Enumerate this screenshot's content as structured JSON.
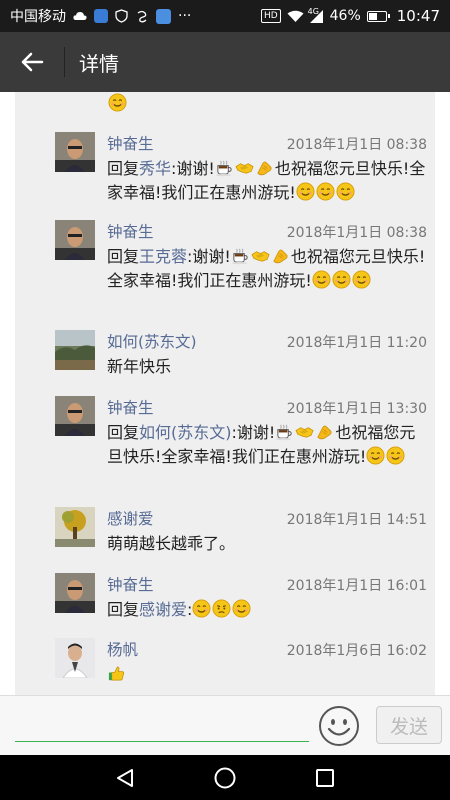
{
  "status_bar": {
    "carrier": "中国移动",
    "network": "4G",
    "battery_text": "46%",
    "battery_level": 0.46,
    "time": "10:47",
    "more": "···",
    "hd": "HD"
  },
  "header": {
    "title": "详情",
    "back_icon": "arrow-left-icon"
  },
  "comments": [
    {
      "name": "钟奋生",
      "time": "2018年1月1日 08:38",
      "reply_prefix": "回复",
      "reply_to": "秀华",
      "text_line1": ":谢谢!",
      "text_mid": "也祝福您元旦快乐!全家幸福!我们正在惠州游玩!",
      "avatar": "avatar-man-glasses"
    },
    {
      "name": "钟奋生",
      "time": "2018年1月1日 08:38",
      "reply_prefix": "回复",
      "reply_to": "王克蓉",
      "text_line1": ":谢谢!",
      "text_mid": "也祝福您元旦快乐!全家幸福!我们正在惠州游玩!",
      "avatar": "avatar-man-glasses"
    },
    {
      "name": "如何(苏东文)",
      "time": "2018年1月1日 11:20",
      "text": "新年快乐",
      "avatar": "avatar-landscape"
    },
    {
      "name": "钟奋生",
      "time": "2018年1月1日 13:30",
      "reply_prefix": "回复",
      "reply_to": "如何(苏东文)",
      "text_line1": ":谢谢!",
      "text_mid": "也祝福您元旦快乐!全家幸福!我们正在惠州游玩!",
      "avatar": "avatar-man-glasses"
    },
    {
      "name": "感谢爱",
      "time": "2018年1月1日 14:51",
      "text": "萌萌越长越乖了。",
      "avatar": "avatar-tree"
    },
    {
      "name": "钟奋生",
      "time": "2018年1月1日 16:01",
      "reply_prefix": "回复",
      "reply_to": "感谢爱",
      "text_line1": ":",
      "avatar": "avatar-man-glasses"
    },
    {
      "name": "杨帆",
      "time": "2018年1月6日 16:02",
      "avatar": "avatar-man-white"
    }
  ],
  "input_bar": {
    "placeholder": "",
    "emoji_icon": "smiley-icon",
    "send_label": "发送"
  },
  "nav_bar": {
    "back": "triangle-back-icon",
    "home": "circle-home-icon",
    "recent": "square-recent-icon"
  },
  "colors": {
    "header_bg": "#3a3a3a",
    "name_color": "#576b95",
    "input_underline": "#3bb34a"
  }
}
